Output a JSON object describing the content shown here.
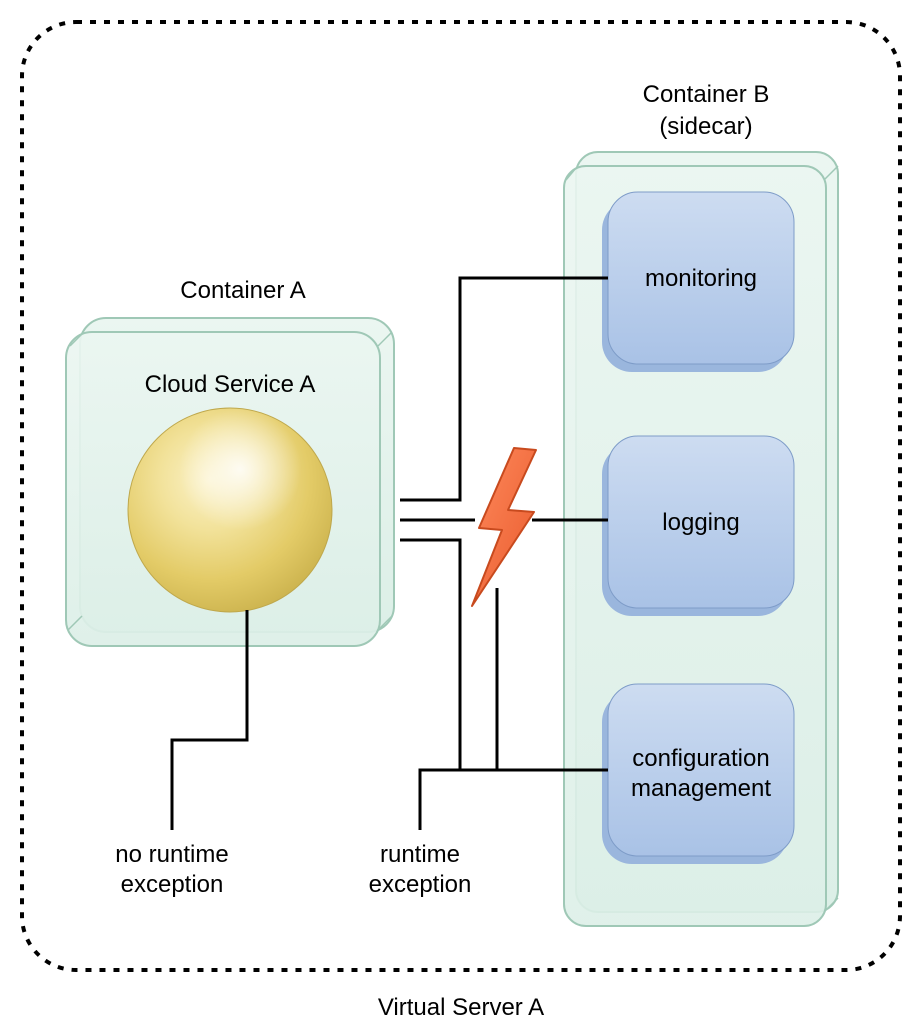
{
  "server_label": "Virtual Server A",
  "containerA": {
    "title": "Container A",
    "service_label": "Cloud Service A",
    "note": [
      "no runtime",
      "exception"
    ]
  },
  "containerB": {
    "title": [
      "Container B",
      "(sidecar)"
    ],
    "modules": {
      "monitoring": "monitoring",
      "logging": "logging",
      "config": [
        "configuration",
        "management"
      ]
    }
  },
  "fault_label": [
    "runtime",
    "exception"
  ]
}
